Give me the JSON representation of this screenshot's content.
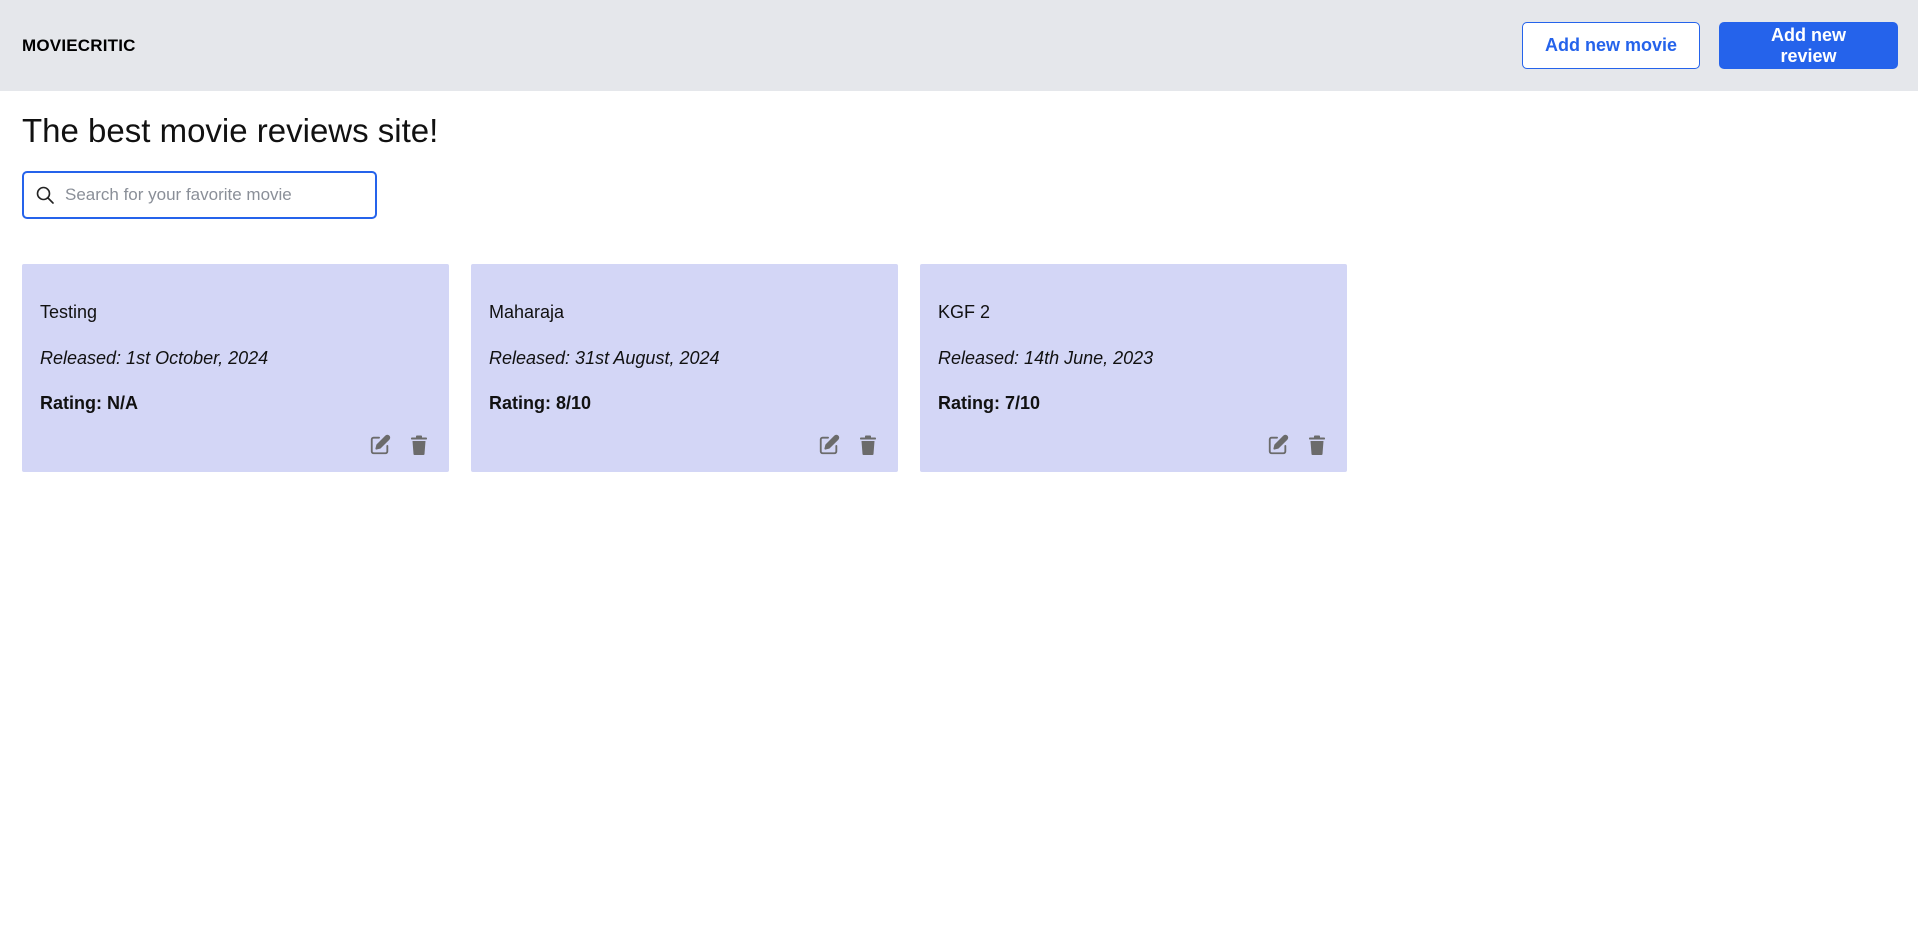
{
  "header": {
    "brand": "MOVIECRITIC",
    "add_movie_label": "Add new movie",
    "add_review_label": "Add new review"
  },
  "main": {
    "title": "The best movie reviews site!",
    "search": {
      "placeholder": "Search for your favorite movie",
      "value": "",
      "icon": "search-icon"
    }
  },
  "movies": [
    {
      "title": "Testing",
      "released": "Released: 1st October, 2024",
      "rating": "Rating: N/A"
    },
    {
      "title": "Maharaja",
      "released": "Released: 31st August, 2024",
      "rating": "Rating: 8/10"
    },
    {
      "title": "KGF 2",
      "released": "Released: 14th June, 2023",
      "rating": "Rating: 7/10"
    }
  ],
  "card_icons": {
    "edit": "edit-icon",
    "delete": "trash-icon"
  },
  "colors": {
    "header_bg": "#e5e7eb",
    "accent": "#2563eb",
    "card_bg": "#d3d6f6",
    "icon": "#6b6b6b"
  }
}
